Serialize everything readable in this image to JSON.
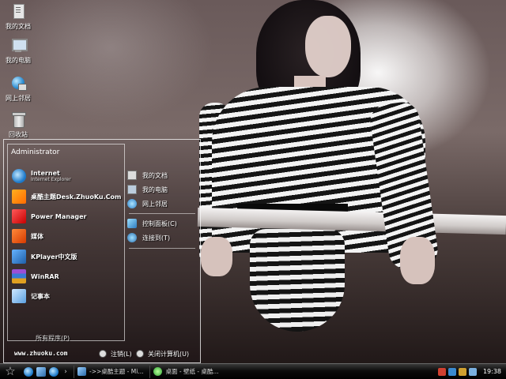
{
  "desktop_icons": [
    {
      "label": "我的文档",
      "icon": "documents-icon"
    },
    {
      "label": "我的电脑",
      "icon": "computer-icon"
    },
    {
      "label": "网上邻居",
      "icon": "network-icon"
    },
    {
      "label": "回收站",
      "icon": "recycle-bin-icon"
    }
  ],
  "start_menu": {
    "user": "Administrator",
    "pinned": [
      {
        "label": "Internet",
        "sub": "Internet Explorer"
      },
      {
        "label": "桌酷主题Desk.ZhuoKu.Com"
      }
    ],
    "programs": [
      {
        "label": "Power Manager"
      },
      {
        "label": "媒体"
      },
      {
        "label": "KPlayer中文版"
      },
      {
        "label": "WinRAR"
      },
      {
        "label": "记事本"
      }
    ],
    "all_programs": "所有程序(P)",
    "places": [
      {
        "label": "我的文档"
      },
      {
        "label": "我的电脑"
      },
      {
        "label": "网上邻居"
      }
    ],
    "system": [
      {
        "label": "控制面板(C)"
      },
      {
        "label": "连接到(T)"
      }
    ],
    "footer": {
      "url": "www.zhuoku.com",
      "logoff": "注销(L)",
      "shutdown": "关闭计算机(U)"
    }
  },
  "taskbar": {
    "tasks": [
      {
        "label": "->>桌酷主题 - Mi..."
      },
      {
        "label": "桌面 - 壁纸 - 桌酷..."
      }
    ],
    "clock": "19:38"
  }
}
